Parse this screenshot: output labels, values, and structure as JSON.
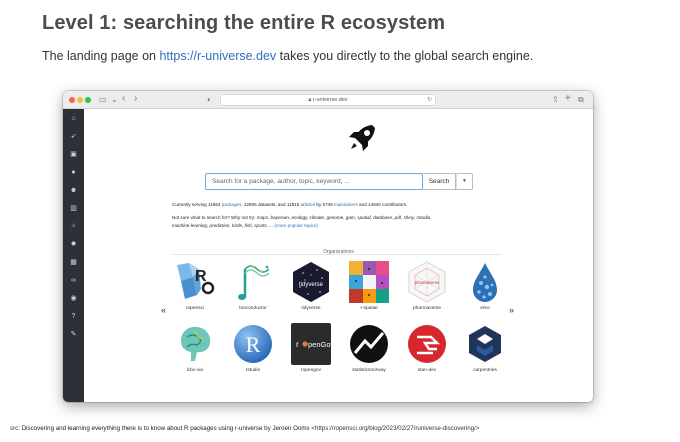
{
  "slide": {
    "title": "Level 1: searching the entire R ecosystem",
    "subtitle_before": "The landing page on ",
    "subtitle_link": "https://r-universe.dev",
    "subtitle_after": " takes you directly to the global search engine."
  },
  "browser": {
    "url": "r-universe.dev",
    "nav_back": "‹",
    "nav_forward": "›"
  },
  "sidebar": {
    "icons": [
      "home-icon",
      "rocket-icon",
      "book-icon",
      "globe-icon",
      "users-icon",
      "chart-icon",
      "network-icon",
      "gear-icon",
      "grid-icon",
      "link-icon",
      "eye-icon",
      "question-icon",
      "wrench-icon"
    ]
  },
  "page": {
    "search_placeholder": "Search for a package, author, topic, keyword, ...",
    "search_button": "Search",
    "search_dropdown": "▼",
    "stats_1": "Currently serving 11864 ",
    "stats_packages": "packages",
    "stats_2": ", 22805 datasets, and 11915 ",
    "stats_articles": "articles",
    "stats_3": " by 5748 ",
    "stats_maintainers": "maintainers",
    "stats_4": " and 14840 contributors.",
    "tips_line1_a": "Not sure what to search for? Why not try: ",
    "tips_line1_b": "maps, bayesian, ecology, climate, genome, gam, spatial, database, pdf, shiny, rstudio,",
    "tips_line2_a": "machine learning, prediction, birds, fish, sports, ...",
    "tips_line2_more": " (more popular topics)",
    "organizations_heading": "Organizations",
    "prev_arrow": "«",
    "next_arrow": "»"
  },
  "organizations": [
    {
      "name": "ropensci"
    },
    {
      "name": "bioconductor"
    },
    {
      "name": "tidyverse"
    },
    {
      "name": "r-spatial"
    },
    {
      "name": "pharmaverse"
    },
    {
      "name": "vimc"
    },
    {
      "name": "lcbc-uio"
    },
    {
      "name": "rstudio"
    },
    {
      "name": "ropengov"
    },
    {
      "name": "statisticsnorway"
    },
    {
      "name": "stan-dev"
    },
    {
      "name": "carpentries"
    }
  ],
  "logo_text": {
    "ropensci": "R",
    "tidyverse": "tidyverse",
    "pharmaverse": "pharmaverse",
    "rstudio": "R",
    "ropengov_r": "r",
    "ropengov_rest": "penGov"
  },
  "caption": {
    "prefix": "src: ",
    "title": "Discovering and learning everything there is to know about R packages using r-universe",
    "by": " by ",
    "author": "Jeroen Ooms",
    "url": " <https://ropensci.org/blog/2023/02/27/runiverse-discovering/>"
  },
  "colors": {
    "accent_link": "#2f6fbf",
    "sidebar_bg": "#2d3036",
    "search_border": "#6ea8dc"
  }
}
